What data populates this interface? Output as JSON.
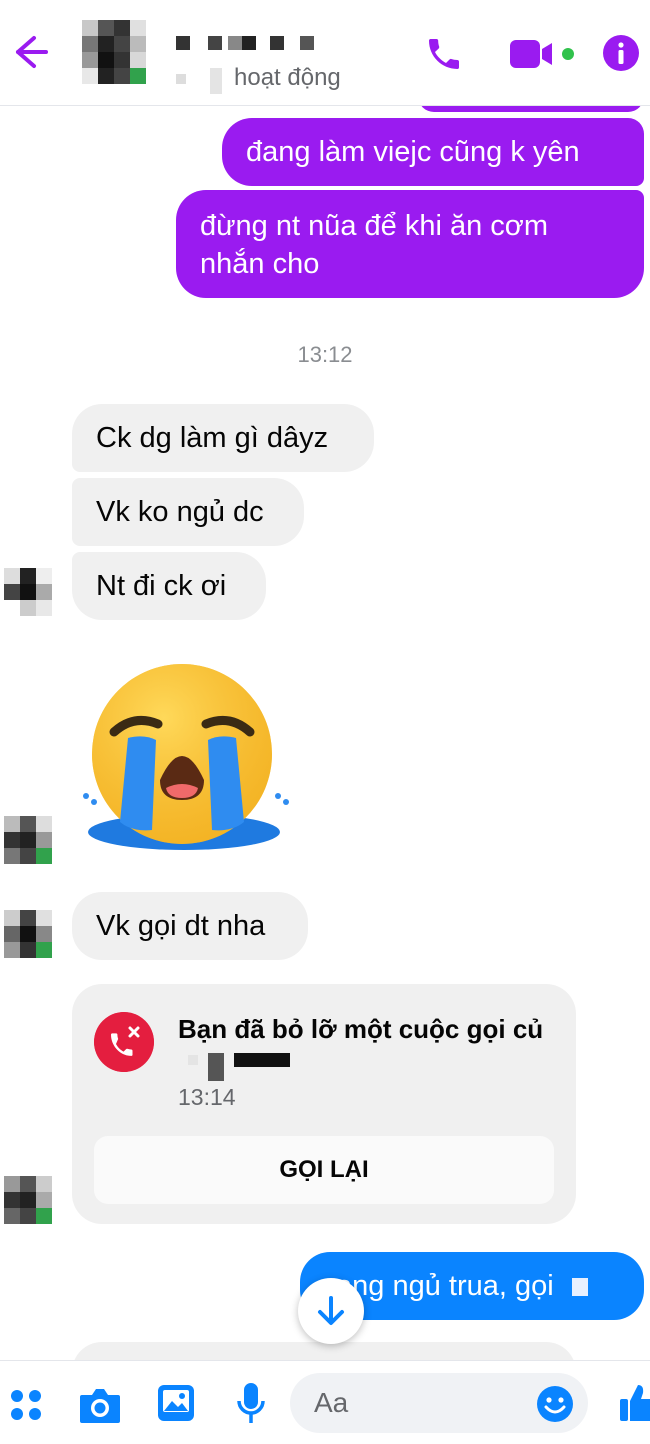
{
  "header": {
    "contact_name": "",
    "status": "hoạt động",
    "accent_color": "#9a1bf0",
    "icons": [
      "back-arrow-icon",
      "phone-icon",
      "video-camera-icon",
      "info-icon"
    ]
  },
  "messages": {
    "outgoing_1": "đang làm viejc cũng k yên",
    "outgoing_2": "đừng nt nũa để khi ăn cơm nhắn cho",
    "timestamp": "13:12",
    "incoming_1": "Ck dg làm gì dâyz",
    "incoming_2": "Vk ko ngủ dc",
    "incoming_3": "Nt đi ck ơi",
    "sticker": "crying-face-sticker",
    "incoming_4": "Vk gọi dt nha",
    "outgoing_3": "ang ngủ trua, gọi"
  },
  "missed_call": {
    "title": "Bạn đã bỏ lỡ một cuộc gọi củ",
    "time": "13:14",
    "button": "GỌI LẠI"
  },
  "composer": {
    "placeholder": "Aa",
    "icons": [
      "apps-icon",
      "camera-icon",
      "image-icon",
      "microphone-icon",
      "emoji-icon",
      "like-icon"
    ]
  },
  "colors": {
    "outgoing_purple": "#9a1bf0",
    "outgoing_blue": "#0a84ff",
    "incoming_grey": "#f0f0f0",
    "missed_call_red": "#e41e3f"
  }
}
